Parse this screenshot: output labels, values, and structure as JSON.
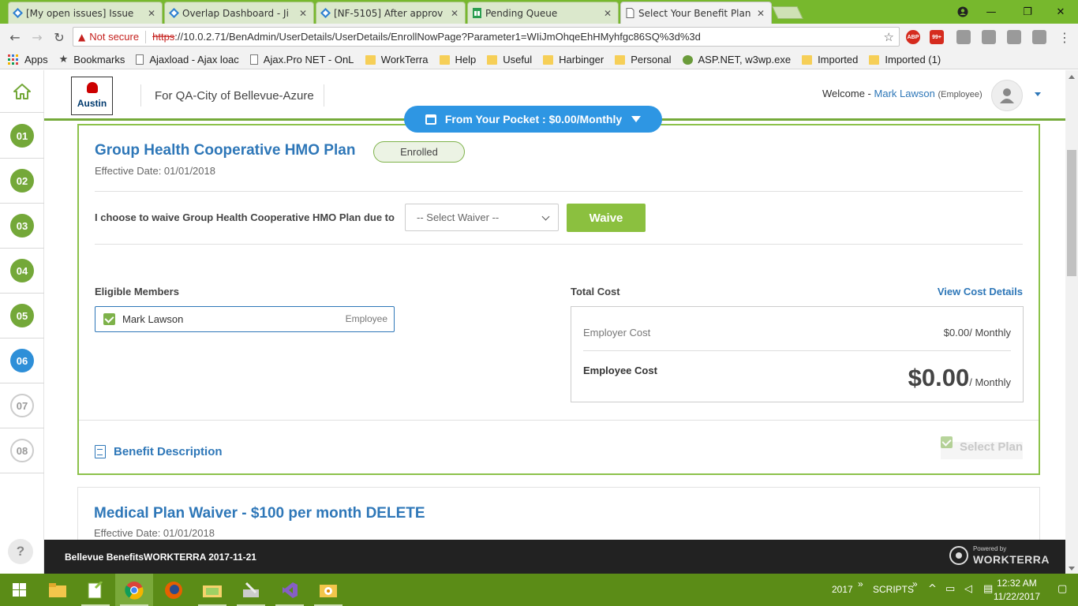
{
  "browser": {
    "tabs": [
      {
        "label": "[My open issues] Issue",
        "icon": "jira-icon"
      },
      {
        "label": "Overlap Dashboard - Ji",
        "icon": "jira-icon"
      },
      {
        "label": "[NF-5105] After approv",
        "icon": "jira-icon"
      },
      {
        "label": "Pending Queue",
        "icon": "sheets-icon"
      },
      {
        "label": "Select Your Benefit Plan",
        "icon": "page-icon"
      }
    ],
    "security_label": "Not secure",
    "url_scheme": "https",
    "url_rest": "://10.0.2.71/BenAdmin/UserDetails/UserDetails/EnrollNowPage?Parameter1=WIiJmOhqeEhHMyhfgc86SQ%3d%3d",
    "ext_badge": "99+",
    "bookmarks": [
      {
        "label": "Apps",
        "icon": "apps-grid-icon"
      },
      {
        "label": "Bookmarks",
        "icon": "star-icon"
      },
      {
        "label": "Ajaxload - Ajax loac",
        "icon": "page-icon"
      },
      {
        "label": "Ajax.Pro NET - OnLc",
        "icon": "page-icon"
      },
      {
        "label": "WorkTerra",
        "icon": "folder-icon"
      },
      {
        "label": "Help",
        "icon": "folder-icon"
      },
      {
        "label": "Useful",
        "icon": "folder-icon"
      },
      {
        "label": "Harbinger",
        "icon": "folder-icon"
      },
      {
        "label": "Personal",
        "icon": "folder-icon"
      },
      {
        "label": "ASP.NET, w3wp.exe",
        "icon": "globe-icon"
      },
      {
        "label": "Imported",
        "icon": "folder-icon"
      },
      {
        "label": "Imported (1)",
        "icon": "folder-icon"
      }
    ]
  },
  "sidebar": {
    "steps": [
      {
        "label": "01",
        "state": "done"
      },
      {
        "label": "02",
        "state": "done"
      },
      {
        "label": "03",
        "state": "done"
      },
      {
        "label": "04",
        "state": "done"
      },
      {
        "label": "05",
        "state": "done"
      },
      {
        "label": "06",
        "state": "current"
      },
      {
        "label": "07",
        "state": "todo"
      },
      {
        "label": "08",
        "state": "todo"
      }
    ],
    "help_label": "?"
  },
  "header": {
    "logo_text": "Austin",
    "tenant": "For QA-City of Bellevue-Azure",
    "welcome_prefix": "Welcome -",
    "user_name": "Mark Lawson",
    "user_role": "(Employee)"
  },
  "pocket": {
    "label": "From Your Pocket : $0.00/Monthly"
  },
  "plan1": {
    "title": "Group Health Cooperative HMO Plan",
    "status": "Enrolled",
    "effective": "Effective Date: 01/01/2018",
    "waive_text": "I choose to waive Group Health Cooperative HMO Plan due to",
    "waiver_placeholder": "-- Select Waiver --",
    "waive_button": "Waive",
    "eligible_label": "Eligible Members",
    "members": [
      {
        "name": "Mark Lawson",
        "role": "Employee",
        "checked": true
      }
    ],
    "total_cost_label": "Total Cost",
    "view_cost_details": "View Cost Details",
    "employer_cost_label": "Employer Cost",
    "employer_cost_value": "$0.00/ Monthly",
    "employee_cost_label": "Employee Cost",
    "employee_cost_amount": "$0.00",
    "employee_cost_period": "/ Monthly",
    "benefit_description": "Benefit Description",
    "select_plan": "Select Plan"
  },
  "plan2": {
    "title": "Medical Plan Waiver - $100 per month DELETE",
    "effective": "Effective Date: 01/01/2018"
  },
  "footer": {
    "text": "Bellevue BenefitsWORKTERRA 2017-11-21",
    "powered_by": "Powered by",
    "brand": "WORKTERRA"
  },
  "taskbar": {
    "items": [
      "start",
      "file-explorer",
      "notepad-plus",
      "chrome",
      "firefox",
      "folder-shortcut",
      "tools",
      "visual-studio",
      "sql-tool"
    ],
    "year_label": "2017",
    "scripts_label": "SCRIPTS",
    "time": "12:32 AM",
    "date": "11/22/2017"
  },
  "colors": {
    "accent_green": "#8bc03f",
    "link_blue": "#2e77b8",
    "pocket_blue": "#2e96e3",
    "chrome_frame": "#77b82d"
  }
}
